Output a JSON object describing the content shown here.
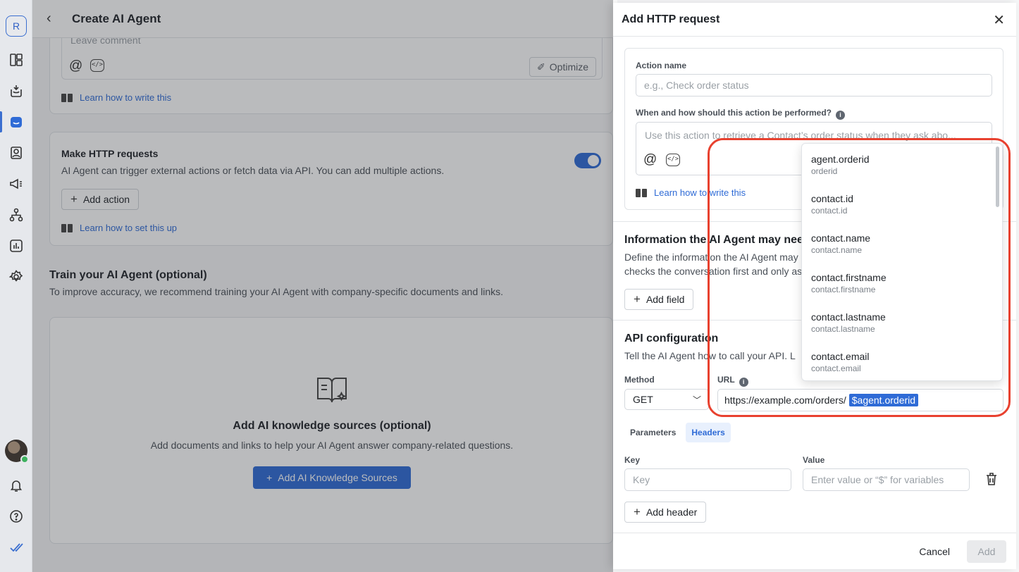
{
  "workspace_initial": "R",
  "header": {
    "title": "Create AI Agent"
  },
  "comment_box": {
    "placeholder": "Leave comment",
    "optimize_label": "Optimize",
    "learn_link": "Learn how to write this"
  },
  "http_card": {
    "title": "Make HTTP requests",
    "description": "AI Agent can trigger external actions or fetch data via API. You can add multiple actions.",
    "toggle_on": true,
    "add_action": "Add action",
    "learn_link": "Learn how to set this up"
  },
  "train": {
    "title": "Train your AI Agent (optional)",
    "description": "To improve accuracy, we recommend training your AI Agent with company-specific documents and links."
  },
  "knowledge": {
    "title": "Add AI knowledge sources (optional)",
    "description": "Add documents and links to help your AI Agent answer company-related questions.",
    "button": "Add AI Knowledge Sources"
  },
  "drawer": {
    "title": "Add HTTP request",
    "action_name_label": "Action name",
    "action_name_placeholder": "e.g., Check order status",
    "when_label": "When and how should this action be performed?",
    "when_placeholder": "Use this action to retrieve a Contact’s order status when they ask abo...",
    "learn_link": "Learn how to write this",
    "info_title": "Information the AI Agent may need",
    "info_desc_line1": "Define the information the AI Agent may need",
    "info_desc_line2": "checks the conversation first and only asks",
    "add_field": "Add field",
    "api_title": "API configuration",
    "api_desc": "Tell the AI Agent how to call your API. L",
    "method_label": "Method",
    "method_value": "GET",
    "url_label": "URL",
    "url_value": "https://example.com/orders/",
    "url_variable": "$agent.orderid",
    "tab_parameters": "Parameters",
    "tab_headers": "Headers",
    "key_label": "Key",
    "key_placeholder": "Key",
    "value_label": "Value",
    "value_placeholder": "Enter value or “$” for variables",
    "add_header": "Add header",
    "cancel": "Cancel",
    "add": "Add"
  },
  "variables": [
    {
      "name": "agent.orderid",
      "sub": "orderid"
    },
    {
      "name": "contact.id",
      "sub": "contact.id"
    },
    {
      "name": "contact.name",
      "sub": "contact.name"
    },
    {
      "name": "contact.firstname",
      "sub": "contact.firstname"
    },
    {
      "name": "contact.lastname",
      "sub": "contact.lastname"
    },
    {
      "name": "contact.email",
      "sub": "contact.email"
    }
  ],
  "colors": {
    "accent": "#2f6bd6",
    "highlight": "#e8412f"
  }
}
